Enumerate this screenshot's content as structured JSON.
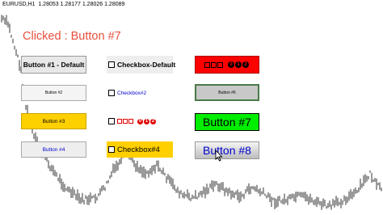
{
  "header": {
    "symbol_label": "EURUSD,H1",
    "ohlc": "1.28053 1.28177 1.28026 1.28089"
  },
  "status": {
    "clicked_text": "Clicked : Button #7"
  },
  "buttons": {
    "b1": "Button #1 - Default",
    "b2": "Button #2",
    "b3": "Button #3",
    "b4": "Button #4",
    "b5_digits": [
      "0",
      "1",
      "2"
    ],
    "b6": "Button #6",
    "b7": "Button #7",
    "b8": "Button #8"
  },
  "checkboxes": {
    "c1": "Checkbox-Default",
    "c2": "Checkbox#2",
    "c3_digits": [
      "0",
      "1",
      "2"
    ],
    "c4": "Checkbox#4"
  },
  "colors": {
    "clicked_text": "#e8503c",
    "button3_bg": "#ffd000",
    "button5_bg": "#ff0000",
    "button7_bg": "#00ee00",
    "checkbox4_bg": "#ffd000",
    "button4_text": "#0000cc",
    "button8_text": "#0000cc",
    "checkbox2_text": "#0000cc",
    "checkbox3_symbols": "#e00000"
  },
  "icons": {
    "button5_symbols": "square-glyphs",
    "checkbox3_symbols": "square-glyphs",
    "mouse_pointer": "arrow-cursor-icon"
  }
}
